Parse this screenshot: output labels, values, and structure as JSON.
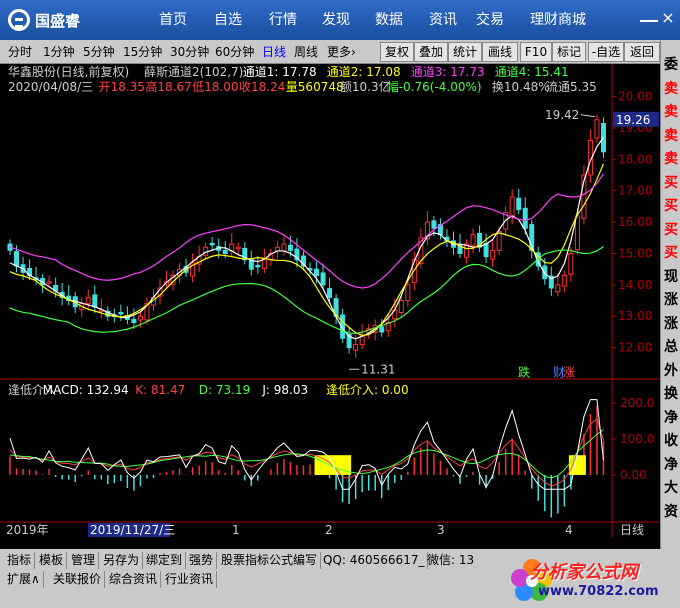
{
  "app": {
    "logo": "国盛睿",
    "nav": [
      "首页",
      "自选",
      "行情",
      "发现",
      "数据",
      "资讯",
      "交易",
      "理财商城"
    ],
    "close": "×"
  },
  "toolbar": {
    "left": [
      "分时",
      "1分钟",
      "5分钟",
      "15分钟",
      "30分钟",
      "60分钟",
      "日线",
      "周线",
      "更多"
    ],
    "more_arrow": "›",
    "right": [
      "复权",
      "叠加",
      "统计",
      "画线",
      "F10",
      "标记",
      "-自选",
      "返回"
    ]
  },
  "main_header": {
    "line1": [
      {
        "text": "华鑫股份(日线,前复权)",
        "color": "#cccccc"
      },
      {
        "text": "薛斯通道2(102,7)",
        "color": "#cccccc"
      },
      {
        "text": "通道1: 17.78",
        "color": "#ffffff"
      },
      {
        "text": "通道2: 17.08",
        "color": "#ffff00"
      },
      {
        "text": "通道3: 17.73",
        "color": "#ff40ff"
      },
      {
        "text": "通道4: 15.41",
        "color": "#40ff40"
      }
    ],
    "line2": [
      {
        "text": "2020/04/08/三",
        "color": "#cccccc"
      },
      {
        "text": "开18.35",
        "color": "#ff4040"
      },
      {
        "text": "高18.67",
        "color": "#ff4040"
      },
      {
        "text": "低18.00",
        "color": "#ff4040"
      },
      {
        "text": "收18.24",
        "color": "#ff4040"
      },
      {
        "text": "量560748",
        "color": "#ffff00"
      },
      {
        "text": "额10.3亿",
        "color": "#cccccc"
      },
      {
        "text": "幅-0.76(-4.00%)",
        "color": "#40ff40"
      },
      {
        "text": "换10.48%",
        "color": "#cccccc"
      },
      {
        "text": "流通5.35",
        "color": "#cccccc"
      }
    ]
  },
  "price_axis": [
    "20.00",
    "19.00",
    "18.00",
    "17.00",
    "16.00",
    "15.00",
    "14.00",
    "13.00",
    "12.00"
  ],
  "price_current": "19.26",
  "annotations": {
    "high": "19.42",
    "low": "11.31",
    "tag_green": "跌",
    "tag_red": "涨",
    "tag_blue": "财"
  },
  "sub_header": [
    {
      "text": "逢低介入",
      "color": "#cccccc"
    },
    {
      "text": "MACD: 132.94",
      "color": "#ffffff"
    },
    {
      "text": "K: 81.47",
      "color": "#ff4040"
    },
    {
      "text": "D: 73.19",
      "color": "#40ff40"
    },
    {
      "text": "J: 98.03",
      "color": "#ffffff"
    },
    {
      "text": "逢低介入: 0.00",
      "color": "#ffff00"
    }
  ],
  "sub_axis": [
    "200.0",
    "100.0",
    "0.00"
  ],
  "date_axis": {
    "year": "2019年",
    "selected": "2019/11/27/三",
    "months": [
      "1",
      "2",
      "3",
      "4"
    ],
    "period": "日线"
  },
  "sidebar": [
    {
      "t": "委",
      "c": "#000000"
    },
    {
      "t": "卖",
      "c": "#ff0000"
    },
    {
      "t": "卖",
      "c": "#ff0000"
    },
    {
      "t": "卖",
      "c": "#ff0000"
    },
    {
      "t": "卖",
      "c": "#ff0000"
    },
    {
      "t": "买",
      "c": "#ff0000"
    },
    {
      "t": "买",
      "c": "#ff0000"
    },
    {
      "t": "买",
      "c": "#ff0000"
    },
    {
      "t": "买",
      "c": "#ff0000"
    },
    {
      "t": "现",
      "c": "#000000"
    },
    {
      "t": "涨",
      "c": "#000000"
    },
    {
      "t": "涨",
      "c": "#000000"
    },
    {
      "t": "总",
      "c": "#000000"
    },
    {
      "t": "外",
      "c": "#000000"
    },
    {
      "t": "换",
      "c": "#000000"
    },
    {
      "t": "净",
      "c": "#000000"
    },
    {
      "t": "收",
      "c": "#000000"
    },
    {
      "t": "净",
      "c": "#000000"
    },
    {
      "t": "大",
      "c": "#000000"
    },
    {
      "t": "资",
      "c": "#000000"
    }
  ],
  "status": {
    "row1": [
      "指标",
      "模板",
      "管理",
      "另存为",
      "绑定到",
      "强势",
      "股票指标公式编写",
      "QQ: 460566617_",
      "微信: 13"
    ],
    "row2": [
      "扩展∧",
      "关联报价",
      "综合资讯",
      "行业资讯"
    ]
  },
  "brand": {
    "name": "分析家公式网",
    "url": "www.70822.com"
  },
  "chart_data": [
    {
      "type": "candlestick",
      "title": "华鑫股份(日线,前复权)",
      "ylim": [
        11.0,
        20.4
      ],
      "price_series_close": [
        15.1,
        14.6,
        14.4,
        14.3,
        14.2,
        14.0,
        14.1,
        13.8,
        13.6,
        13.5,
        13.3,
        13.4,
        13.6,
        13.3,
        13.2,
        13.0,
        13.0,
        13.1,
        12.9,
        12.8,
        13.0,
        13.4,
        13.6,
        13.9,
        14.1,
        14.3,
        14.5,
        14.4,
        14.7,
        14.9,
        15.2,
        15.3,
        15.1,
        15.0,
        15.3,
        15.2,
        14.8,
        14.5,
        14.6,
        14.8,
        15.0,
        15.2,
        15.3,
        15.1,
        14.8,
        14.6,
        14.5,
        14.3,
        14.0,
        13.6,
        13.0,
        12.3,
        12.0,
        12.1,
        12.4,
        12.6,
        12.7,
        12.5,
        12.8,
        13.2,
        13.5,
        14.0,
        14.8,
        15.5,
        16.0,
        15.8,
        15.6,
        15.4,
        15.2,
        15.0,
        15.3,
        15.6,
        15.2,
        14.9,
        15.1,
        15.7,
        16.3,
        16.8,
        16.4,
        15.8,
        15.1,
        14.6,
        14.2,
        13.9,
        14.0,
        14.3,
        15.0,
        16.2,
        17.5,
        18.6,
        19.26,
        18.24
      ],
      "channels": [
        {
          "name": "通道1",
          "color": "#ffffff"
        },
        {
          "name": "通道2",
          "color": "#ffff00"
        },
        {
          "name": "通道3",
          "color": "#ff40ff"
        },
        {
          "name": "通道4",
          "color": "#40ff40"
        }
      ]
    },
    {
      "type": "bar",
      "title": "逢低介入",
      "ylim": [
        -120,
        220
      ],
      "series": [
        {
          "name": "MACD"
        },
        {
          "name": "K",
          "color": "#ff4040"
        },
        {
          "name": "D",
          "color": "#40ff40"
        },
        {
          "name": "J",
          "color": "#ffffff"
        },
        {
          "name": "逢低介入",
          "color": "#ffff00"
        }
      ]
    }
  ]
}
